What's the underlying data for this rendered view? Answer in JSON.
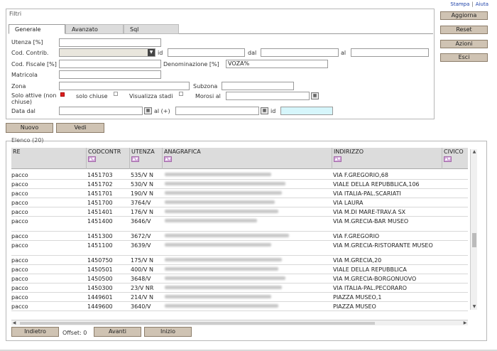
{
  "toplinks": {
    "stampa": "Stampa",
    "sep": "|",
    "aiuta": "Aiuta"
  },
  "right_buttons": {
    "aggiorna": "Aggiorna",
    "reset": "Reset",
    "azioni": "Azioni",
    "esci": "Esci"
  },
  "filtri": {
    "legend": "Filtri",
    "tabs": [
      "Generale",
      "Avanzato",
      "Sql"
    ],
    "labels": {
      "utenza": "Utenza [%]",
      "cod_contrib": "Cod. Contrib.",
      "id": "id",
      "dal": "dal",
      "al": "al",
      "cod_fiscale": "Cod. Fiscale [%]",
      "denominazione": "Denominazione [%]",
      "matricola": "Matricola",
      "zona": "Zona",
      "subzona": "Subzona",
      "solo_attive": "Solo attive (non chiuse)",
      "solo_chiuse": "solo chiuse",
      "visualizza_stadi": "Visualizza stadi",
      "morosi_al": "Morosi al",
      "data_dal": "Data dal",
      "al_piu": "al (+)",
      "id2": "id"
    },
    "values": {
      "denominazione": "VOZA%"
    }
  },
  "buttons": {
    "nuovo": "Nuovo",
    "vedi": "Vedi"
  },
  "grid": {
    "caption": "Elenco (20)",
    "columns": [
      "RE",
      "CODCONTR",
      "UTENZA",
      "ANAGRAFICA",
      "INDIRIZZO",
      "CIVICO"
    ],
    "rows": [
      {
        "re": "pacco",
        "cod": "1451703",
        "ut": "535/V N",
        "ind": "VIA F.GREGORIO,68"
      },
      {
        "re": "pacco",
        "cod": "1451702",
        "ut": "530/V N",
        "ind": "VIALE DELLA REPUBBLICA,106"
      },
      {
        "re": "pacco",
        "cod": "1451701",
        "ut": "190/V N",
        "ind": "VIA ITALIA-PAL.SCARIATI"
      },
      {
        "re": "pacco",
        "cod": "1451700",
        "ut": "3764/V",
        "ind": "VIA LAURA"
      },
      {
        "re": "pacco",
        "cod": "1451401",
        "ut": "176/V N",
        "ind": "VIA M.DI MARE-TRAV.A SX"
      },
      {
        "re": "pacco",
        "cod": "1451400",
        "ut": "3646/V",
        "ind": "VIA M.GRECIA-BAR MUSEO"
      },
      {
        "re": "pacco",
        "cod": "1451300",
        "ut": "3672/V",
        "ind": "VIA F.GREGORIO"
      },
      {
        "re": "pacco",
        "cod": "1451100",
        "ut": "3639/V",
        "ind": "VIA M.GRECIA-RISTORANTE MUSEO"
      },
      {
        "re": "pacco",
        "cod": "1450750",
        "ut": "175/V N",
        "ind": "VIA M.GRECIA,20"
      },
      {
        "re": "pacco",
        "cod": "1450501",
        "ut": "400/V N",
        "ind": "VIALE DELLA REPUBBLICA"
      },
      {
        "re": "pacco",
        "cod": "1450500",
        "ut": "3648/V",
        "ind": "VIA M.GRECIA-BORGONUOVO"
      },
      {
        "re": "pacco",
        "cod": "1450300",
        "ut": "23/V NR",
        "ind": "VIA ITALIA-PAL.PECORARO"
      },
      {
        "re": "pacco",
        "cod": "1449601",
        "ut": "214/V N",
        "ind": "PIAZZA MUSEO,1"
      },
      {
        "re": "pacco",
        "cod": "1449600",
        "ut": "3640/V",
        "ind": "PIAZZA MUSEO"
      }
    ]
  },
  "footer": {
    "indietro": "Indietro",
    "offset": "Offset: 0",
    "avanti": "Avanti",
    "inizio": "Inizio"
  }
}
